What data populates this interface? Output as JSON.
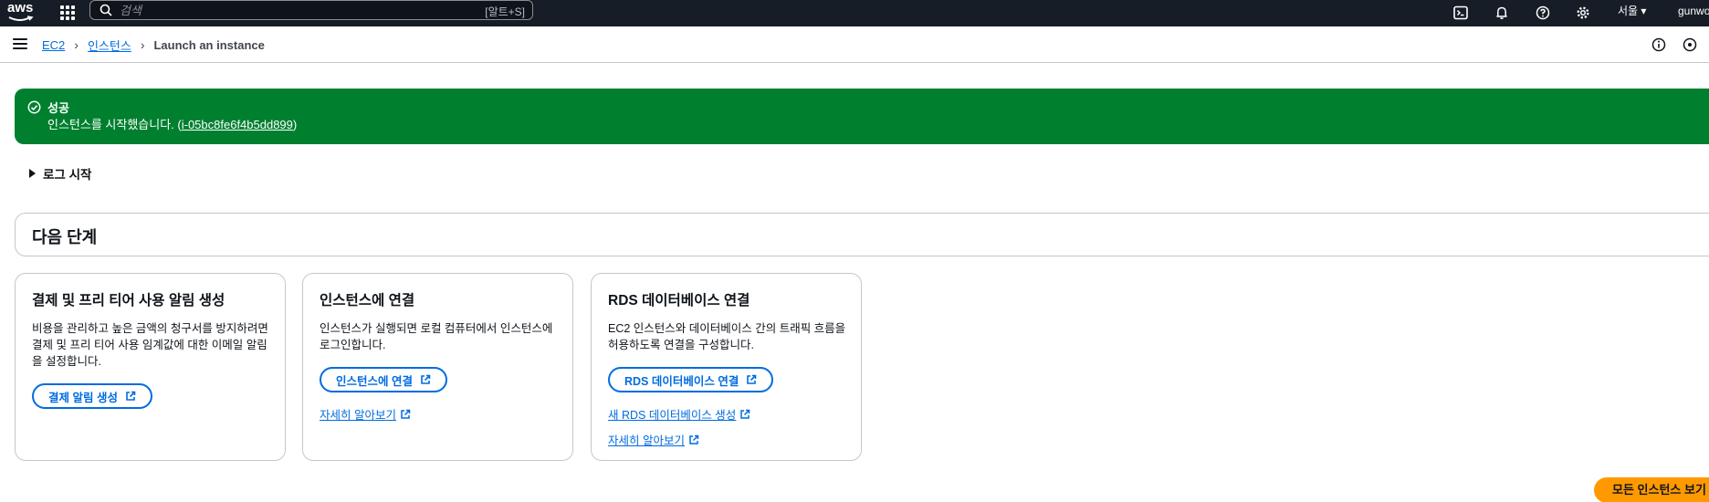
{
  "topnav": {
    "logo": "aws",
    "search_placeholder": "검색",
    "search_shortcut": "[알트+S]",
    "region": "서울 ▾",
    "user": "gunwo"
  },
  "breadcrumb": {
    "items": [
      "EC2",
      "인스턴스"
    ],
    "current": "Launch an instance"
  },
  "flash": {
    "title": "성공",
    "message_prefix": "인스턴스를 시작했습니다. (",
    "instance_id": "i-05bc8fe6f4b5dd899",
    "message_suffix": ")",
    "color": "#00802f"
  },
  "log_toggle": "로그 시작",
  "next_steps": {
    "title": "다음 단계",
    "cards": [
      {
        "title": "결제 및 프리 티어 사용 알림 생성",
        "desc": "비용을 관리하고 높은 금액의 청구서를 방지하려면 결제 및 프리 티어 사용 임계값에 대한 이메일 알림을 설정합니다.",
        "button": "결제 알림 생성"
      },
      {
        "title": "인스턴스에 연결",
        "desc": "인스턴스가 실행되면 로컬 컴퓨터에서 인스턴스에 로그인합니다.",
        "button": "인스턴스에 연결",
        "link1": "자세히 알아보기"
      },
      {
        "title": "RDS 데이터베이스 연결",
        "desc": "EC2 인스턴스와 데이터베이스 간의 트래픽 흐름을 허용하도록 연결을 구성합니다.",
        "button": "RDS 데이터베이스 연결",
        "link1": "새 RDS 데이터베이스 생성",
        "link2": "자세히 알아보기"
      }
    ]
  },
  "view_all_button": "모든 인스턴스 보기",
  "colors": {
    "nav_bg": "#161d26",
    "link": "#006ce0",
    "accent": "#ff9900"
  }
}
